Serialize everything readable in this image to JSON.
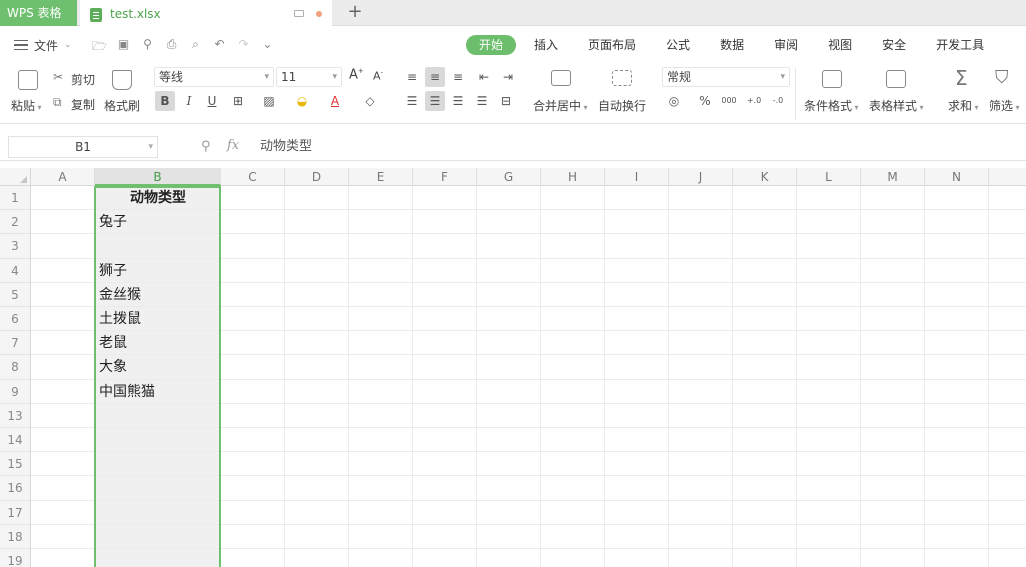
{
  "window": {
    "app_label": "WPS 表格",
    "file_name": "test.xlsx",
    "new_tab": "+"
  },
  "menu": {
    "file_label": "文件",
    "tabs": [
      {
        "label": "开始",
        "active": true
      },
      {
        "label": "插入"
      },
      {
        "label": "页面布局"
      },
      {
        "label": "公式"
      },
      {
        "label": "数据"
      },
      {
        "label": "审阅"
      },
      {
        "label": "视图"
      },
      {
        "label": "安全"
      },
      {
        "label": "开发工具"
      }
    ]
  },
  "ribbon": {
    "paste": "粘贴",
    "cut": "剪切",
    "copy": "复制",
    "format_painter": "格式刷",
    "font_name": "等线",
    "font_size": "11",
    "font_grow": "A",
    "font_shrink": "A",
    "bold": "B",
    "italic": "I",
    "underline": "U",
    "font_color_letter": "A",
    "merge_center": "合并居中",
    "wrap_text": "自动换行",
    "number_format": "常规",
    "percent": "%",
    "thousands": "000",
    "inc_decimal": "+.0",
    "dec_decimal": "-.0",
    "conditional_format": "条件格式",
    "table_style": "表格样式",
    "sum": "求和",
    "filter": "筛选",
    "accent_color": "#6ebf6e"
  },
  "formula_bar": {
    "cell_ref": "B1",
    "fx": "fx",
    "content": "动物类型"
  },
  "sheet": {
    "columns": [
      "A",
      "B",
      "C",
      "D",
      "E",
      "F",
      "G",
      "H",
      "I",
      "J",
      "K",
      "L",
      "M",
      "N"
    ],
    "selected_column": "B",
    "rows": [
      {
        "num": "1",
        "b": "动物类型"
      },
      {
        "num": "2",
        "b": "兔子"
      },
      {
        "num": "3",
        "b": ""
      },
      {
        "num": "4",
        "b": "狮子"
      },
      {
        "num": "5",
        "b": "金丝猴"
      },
      {
        "num": "6",
        "b": "土拨鼠"
      },
      {
        "num": "7",
        "b": "老鼠"
      },
      {
        "num": "8",
        "b": "大象"
      },
      {
        "num": "9",
        "b": "中国熊猫"
      },
      {
        "num": "13",
        "b": ""
      },
      {
        "num": "14",
        "b": ""
      },
      {
        "num": "15",
        "b": ""
      },
      {
        "num": "16",
        "b": ""
      },
      {
        "num": "17",
        "b": ""
      },
      {
        "num": "18",
        "b": ""
      },
      {
        "num": "19",
        "b": ""
      }
    ]
  }
}
